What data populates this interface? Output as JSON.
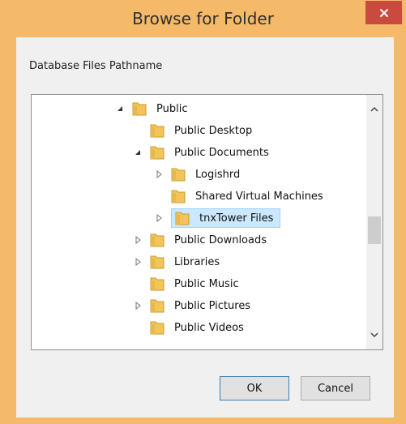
{
  "window": {
    "title": "Browse for Folder"
  },
  "dialog": {
    "prompt": "Database Files Pathname",
    "tree": {
      "items": [
        {
          "label": "Public",
          "expander": "expanded",
          "selected": false
        },
        {
          "label": "Public Desktop",
          "expander": "none",
          "selected": false
        },
        {
          "label": "Public Documents",
          "expander": "expanded",
          "selected": false
        },
        {
          "label": "Logishrd",
          "expander": "collapsed",
          "selected": false
        },
        {
          "label": "Shared Virtual Machines",
          "expander": "none",
          "selected": false
        },
        {
          "label": "tnxTower Files",
          "expander": "collapsed",
          "selected": true
        },
        {
          "label": "Public Downloads",
          "expander": "collapsed",
          "selected": false
        },
        {
          "label": "Libraries",
          "expander": "collapsed",
          "selected": false
        },
        {
          "label": "Public Music",
          "expander": "none",
          "selected": false
        },
        {
          "label": "Public Pictures",
          "expander": "collapsed",
          "selected": false
        },
        {
          "label": "Public Videos",
          "expander": "none",
          "selected": false
        }
      ]
    },
    "buttons": {
      "ok": "OK",
      "cancel": "Cancel"
    }
  },
  "icons": {
    "close": "close-icon",
    "folder": "folder-icon",
    "expanded": "expanded-triangle-icon",
    "collapsed": "collapsed-triangle-icon",
    "scroll_up": "chevron-up-icon",
    "scroll_down": "chevron-down-icon"
  },
  "colors": {
    "frame": "#f4ba6a",
    "close_button": "#c94a3f",
    "selection_fill": "#cce8ff",
    "selection_border": "#99d1ff",
    "folder_fill": "#f3c45a"
  }
}
